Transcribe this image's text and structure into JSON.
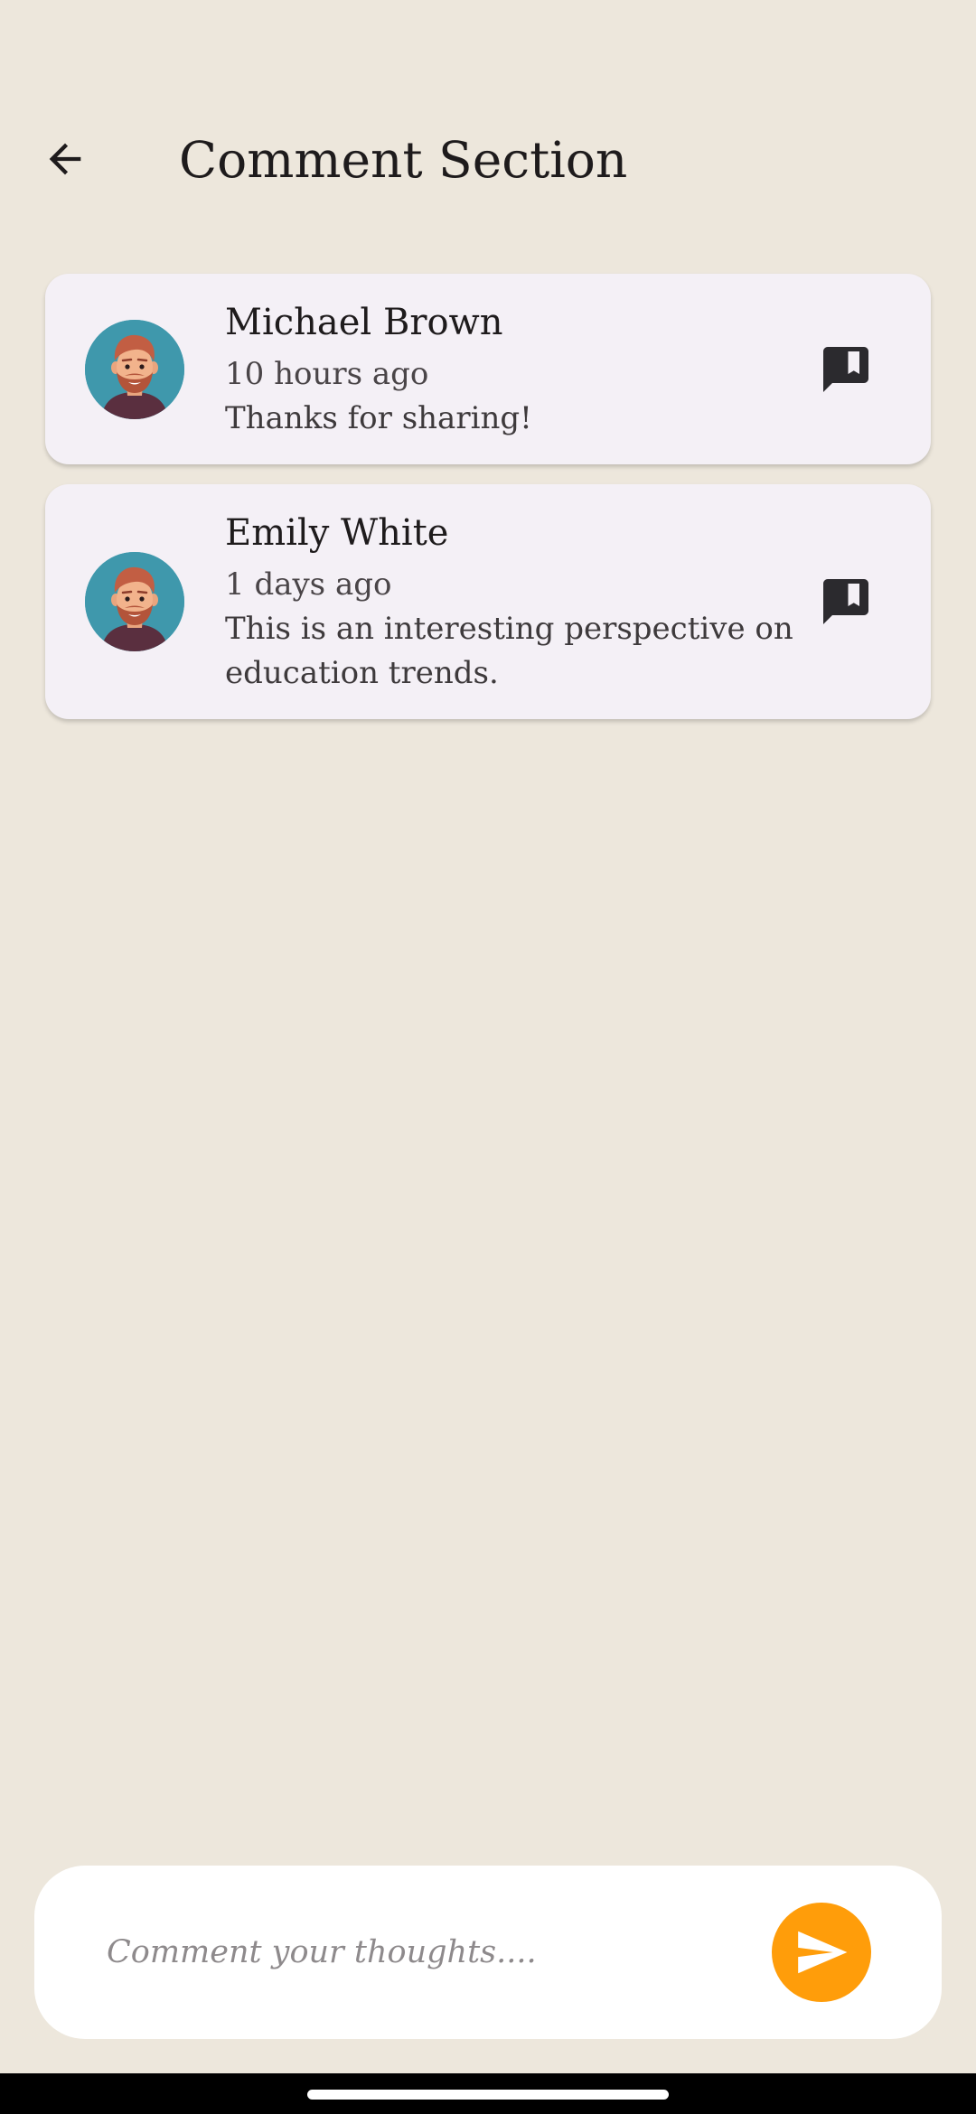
{
  "header": {
    "title": "Comment Section",
    "back_icon": "arrow-back-icon"
  },
  "comments": [
    {
      "author": "Michael Brown",
      "time": "10 hours ago",
      "text": "Thanks for sharing!",
      "action_icon": "report-flag-icon"
    },
    {
      "author": "Emily White",
      "time": "1 days ago",
      "text": "This is an interesting perspective on education trends.",
      "action_icon": "report-flag-icon"
    }
  ],
  "composer": {
    "placeholder": "Comment your thoughts....",
    "value": "",
    "send_icon": "send-icon"
  },
  "colors": {
    "background": "#EDE7DC",
    "card": "#F4F0F6",
    "accent": "#FF9D0A",
    "avatar_bg": "#3F98AC"
  }
}
